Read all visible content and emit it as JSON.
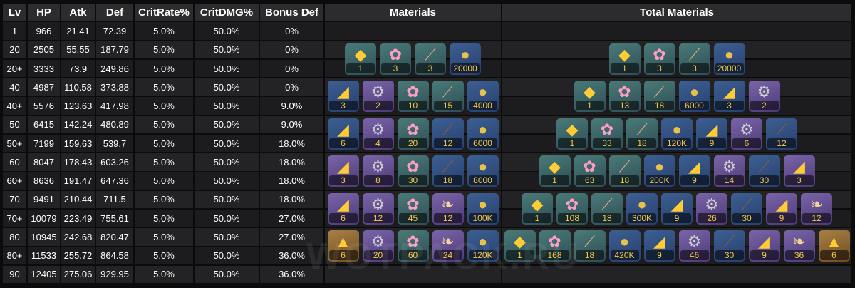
{
  "headers": [
    "Lv",
    "HP",
    "Atk",
    "Def",
    "CritRate%",
    "CritDMG%",
    "Bonus Def",
    "Materials",
    "Total Materials"
  ],
  "rows": [
    {
      "lv": "1",
      "hp": "966",
      "atk": "21.41",
      "def": "72.39",
      "crit_rate": "5.0%",
      "crit_dmg": "50.0%",
      "bonus_def": "0%"
    },
    {
      "lv": "20",
      "hp": "2505",
      "atk": "55.55",
      "def": "187.79",
      "crit_rate": "5.0%",
      "crit_dmg": "50.0%",
      "bonus_def": "0%"
    },
    {
      "lv": "20+",
      "hp": "3333",
      "atk": "73.9",
      "def": "249.86",
      "crit_rate": "5.0%",
      "crit_dmg": "50.0%",
      "bonus_def": "0%"
    },
    {
      "lv": "40",
      "hp": "4987",
      "atk": "110.58",
      "def": "373.88",
      "crit_rate": "5.0%",
      "crit_dmg": "50.0%",
      "bonus_def": "0%"
    },
    {
      "lv": "40+",
      "hp": "5576",
      "atk": "123.63",
      "def": "417.98",
      "crit_rate": "5.0%",
      "crit_dmg": "50.0%",
      "bonus_def": "9.0%"
    },
    {
      "lv": "50",
      "hp": "6415",
      "atk": "142.24",
      "def": "480.89",
      "crit_rate": "5.0%",
      "crit_dmg": "50.0%",
      "bonus_def": "9.0%"
    },
    {
      "lv": "50+",
      "hp": "7199",
      "atk": "159.63",
      "def": "539.7",
      "crit_rate": "5.0%",
      "crit_dmg": "50.0%",
      "bonus_def": "18.0%"
    },
    {
      "lv": "60",
      "hp": "8047",
      "atk": "178.43",
      "def": "603.26",
      "crit_rate": "5.0%",
      "crit_dmg": "50.0%",
      "bonus_def": "18.0%"
    },
    {
      "lv": "60+",
      "hp": "8636",
      "atk": "191.47",
      "def": "647.36",
      "crit_rate": "5.0%",
      "crit_dmg": "50.0%",
      "bonus_def": "18.0%"
    },
    {
      "lv": "70",
      "hp": "9491",
      "atk": "210.44",
      "def": "711.5",
      "crit_rate": "5.0%",
      "crit_dmg": "50.0%",
      "bonus_def": "18.0%"
    },
    {
      "lv": "70+",
      "hp": "10079",
      "atk": "223.49",
      "def": "755.61",
      "crit_rate": "5.0%",
      "crit_dmg": "50.0%",
      "bonus_def": "27.0%"
    },
    {
      "lv": "80",
      "hp": "10945",
      "atk": "242.68",
      "def": "820.47",
      "crit_rate": "5.0%",
      "crit_dmg": "50.0%",
      "bonus_def": "27.0%"
    },
    {
      "lv": "80+",
      "hp": "11533",
      "atk": "255.72",
      "def": "864.58",
      "crit_rate": "5.0%",
      "crit_dmg": "50.0%",
      "bonus_def": "36.0%"
    },
    {
      "lv": "90",
      "hp": "12405",
      "atk": "275.06",
      "def": "929.95",
      "crit_rate": "5.0%",
      "crit_dmg": "50.0%",
      "bonus_def": "36.0%"
    }
  ],
  "materials": [
    [
      {
        "icon": "gem-chunk-icon",
        "rarity": "green",
        "qty": "1"
      },
      {
        "icon": "flower-icon",
        "rarity": "green",
        "qty": "3"
      },
      {
        "icon": "claw-icon",
        "rarity": "green",
        "qty": "3"
      },
      {
        "icon": "coin-icon",
        "rarity": "blue",
        "qty": "20000"
      }
    ],
    [
      {
        "icon": "gem-shard-icon",
        "rarity": "blue",
        "qty": "3"
      },
      {
        "icon": "boss-material-icon",
        "rarity": "purple",
        "qty": "2"
      },
      {
        "icon": "flower-icon",
        "rarity": "green",
        "qty": "10"
      },
      {
        "icon": "claw-icon",
        "rarity": "green",
        "qty": "15"
      },
      {
        "icon": "coin-icon",
        "rarity": "blue",
        "qty": "4000"
      }
    ],
    [
      {
        "icon": "gem-shard-icon",
        "rarity": "blue",
        "qty": "6"
      },
      {
        "icon": "boss-material-icon",
        "rarity": "purple",
        "qty": "4"
      },
      {
        "icon": "flower-icon",
        "rarity": "green",
        "qty": "20"
      },
      {
        "icon": "horn-icon",
        "rarity": "blue",
        "qty": "12"
      },
      {
        "icon": "coin-icon",
        "rarity": "blue",
        "qty": "6000"
      }
    ],
    [
      {
        "icon": "gem-shard-icon",
        "rarity": "purple",
        "qty": "3"
      },
      {
        "icon": "boss-material-icon",
        "rarity": "purple",
        "qty": "8"
      },
      {
        "icon": "flower-icon",
        "rarity": "green",
        "qty": "30"
      },
      {
        "icon": "horn-icon",
        "rarity": "blue",
        "qty": "18"
      },
      {
        "icon": "coin-icon",
        "rarity": "blue",
        "qty": "8000"
      }
    ],
    [
      {
        "icon": "gem-shard-icon",
        "rarity": "purple",
        "qty": "6"
      },
      {
        "icon": "boss-material-icon",
        "rarity": "purple",
        "qty": "12"
      },
      {
        "icon": "flower-icon",
        "rarity": "green",
        "qty": "45"
      },
      {
        "icon": "scroll-icon",
        "rarity": "purple",
        "qty": "12"
      },
      {
        "icon": "coin-icon",
        "rarity": "blue",
        "qty": "100K"
      }
    ],
    [
      {
        "icon": "gem-icon",
        "rarity": "gold",
        "qty": "6"
      },
      {
        "icon": "boss-material-icon",
        "rarity": "purple",
        "qty": "20"
      },
      {
        "icon": "flower-icon",
        "rarity": "green",
        "qty": "60"
      },
      {
        "icon": "scroll-icon",
        "rarity": "purple",
        "qty": "24"
      },
      {
        "icon": "coin-icon",
        "rarity": "blue",
        "qty": "120K"
      }
    ]
  ],
  "total_materials": [
    [
      {
        "icon": "gem-chunk-icon",
        "rarity": "green",
        "qty": "1"
      },
      {
        "icon": "flower-icon",
        "rarity": "green",
        "qty": "3"
      },
      {
        "icon": "claw-icon",
        "rarity": "green",
        "qty": "3"
      },
      {
        "icon": "coin-icon",
        "rarity": "blue",
        "qty": "20000"
      }
    ],
    [
      {
        "icon": "gem-chunk-icon",
        "rarity": "green",
        "qty": "1"
      },
      {
        "icon": "flower-icon",
        "rarity": "green",
        "qty": "13"
      },
      {
        "icon": "claw-icon",
        "rarity": "green",
        "qty": "18"
      },
      {
        "icon": "coin-icon",
        "rarity": "blue",
        "qty": "6000"
      },
      {
        "icon": "gem-shard-icon",
        "rarity": "blue",
        "qty": "3"
      },
      {
        "icon": "boss-material-icon",
        "rarity": "purple",
        "qty": "2"
      }
    ],
    [
      {
        "icon": "gem-chunk-icon",
        "rarity": "green",
        "qty": "1"
      },
      {
        "icon": "flower-icon",
        "rarity": "green",
        "qty": "33"
      },
      {
        "icon": "claw-icon",
        "rarity": "green",
        "qty": "18"
      },
      {
        "icon": "coin-icon",
        "rarity": "blue",
        "qty": "120K"
      },
      {
        "icon": "gem-shard-icon",
        "rarity": "blue",
        "qty": "9"
      },
      {
        "icon": "boss-material-icon",
        "rarity": "purple",
        "qty": "6"
      },
      {
        "icon": "horn-icon",
        "rarity": "blue",
        "qty": "12"
      }
    ],
    [
      {
        "icon": "gem-chunk-icon",
        "rarity": "green",
        "qty": "1"
      },
      {
        "icon": "flower-icon",
        "rarity": "green",
        "qty": "63"
      },
      {
        "icon": "claw-icon",
        "rarity": "green",
        "qty": "18"
      },
      {
        "icon": "coin-icon",
        "rarity": "blue",
        "qty": "200K"
      },
      {
        "icon": "gem-shard-icon",
        "rarity": "blue",
        "qty": "9"
      },
      {
        "icon": "boss-material-icon",
        "rarity": "purple",
        "qty": "14"
      },
      {
        "icon": "horn-icon",
        "rarity": "blue",
        "qty": "30"
      },
      {
        "icon": "gem-shard-icon",
        "rarity": "purple",
        "qty": "3"
      }
    ],
    [
      {
        "icon": "gem-chunk-icon",
        "rarity": "green",
        "qty": "1"
      },
      {
        "icon": "flower-icon",
        "rarity": "green",
        "qty": "108"
      },
      {
        "icon": "claw-icon",
        "rarity": "green",
        "qty": "18"
      },
      {
        "icon": "coin-icon",
        "rarity": "blue",
        "qty": "300K"
      },
      {
        "icon": "gem-shard-icon",
        "rarity": "blue",
        "qty": "9"
      },
      {
        "icon": "boss-material-icon",
        "rarity": "purple",
        "qty": "26"
      },
      {
        "icon": "horn-icon",
        "rarity": "blue",
        "qty": "30"
      },
      {
        "icon": "gem-shard-icon",
        "rarity": "purple",
        "qty": "9"
      },
      {
        "icon": "scroll-icon",
        "rarity": "purple",
        "qty": "12"
      }
    ],
    [
      {
        "icon": "gem-chunk-icon",
        "rarity": "green",
        "qty": "1"
      },
      {
        "icon": "flower-icon",
        "rarity": "green",
        "qty": "168"
      },
      {
        "icon": "claw-icon",
        "rarity": "green",
        "qty": "18"
      },
      {
        "icon": "coin-icon",
        "rarity": "blue",
        "qty": "420K"
      },
      {
        "icon": "gem-shard-icon",
        "rarity": "blue",
        "qty": "9"
      },
      {
        "icon": "boss-material-icon",
        "rarity": "purple",
        "qty": "46"
      },
      {
        "icon": "horn-icon",
        "rarity": "blue",
        "qty": "30"
      },
      {
        "icon": "gem-shard-icon",
        "rarity": "purple",
        "qty": "9"
      },
      {
        "icon": "scroll-icon",
        "rarity": "purple",
        "qty": "36"
      },
      {
        "icon": "gem-icon",
        "rarity": "gold",
        "qty": "6"
      }
    ]
  ],
  "watermark": "WOTPACK.RU",
  "colors": {
    "header_bg": "#2c2c2e",
    "row_bg_a": "#1c1c1e",
    "row_bg_b": "#232325",
    "qty_text": "#f2c94c",
    "page_bg": "#0b0b0c"
  }
}
